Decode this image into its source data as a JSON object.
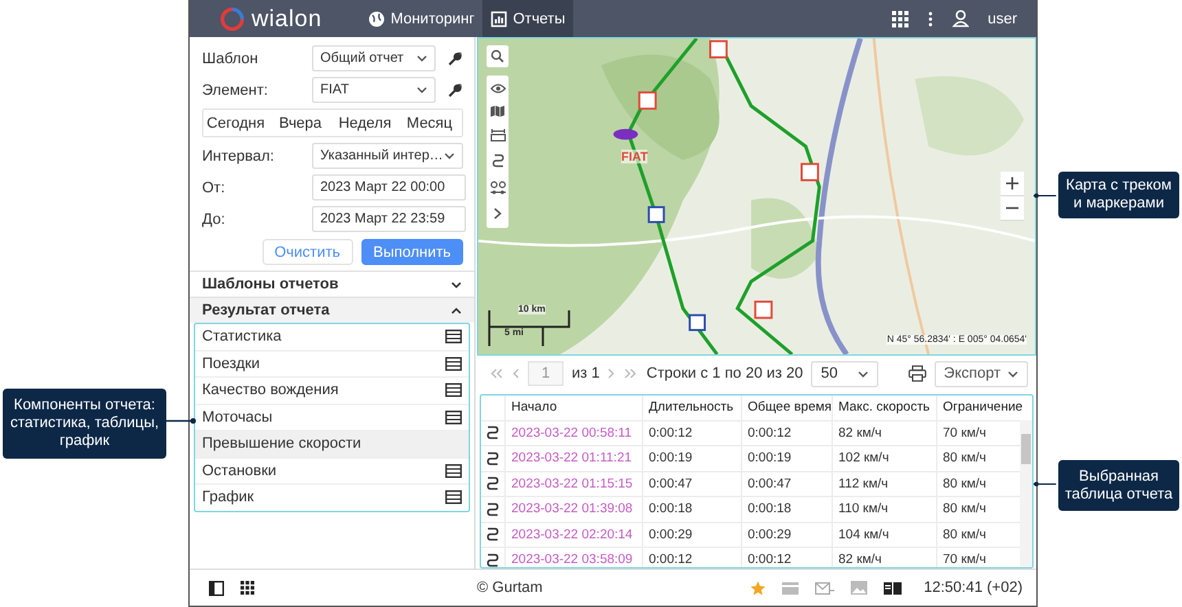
{
  "header": {
    "logo": "wialon",
    "nav": [
      {
        "label": "Мониторинг",
        "selected": false
      },
      {
        "label": "Отчеты",
        "selected": true
      }
    ],
    "user": "user"
  },
  "form": {
    "template": {
      "label": "Шаблон",
      "value": "Общий отчет"
    },
    "element": {
      "label": "Элемент:",
      "value": "FIAT"
    },
    "periods": [
      {
        "label": "Сегодня",
        "selected": false
      },
      {
        "label": "Вчера",
        "selected": false
      },
      {
        "label": "Неделя",
        "selected": false
      },
      {
        "label": "Месяц",
        "selected": false
      }
    ],
    "interval": {
      "label": "Интервал:",
      "value": "Указанный интер…"
    },
    "from": {
      "label": "От:",
      "value": "2023 Март 22 00:00"
    },
    "to": {
      "label": "До:",
      "value": "2023 Март 22 23:59"
    },
    "buttons": [
      {
        "label": "Очистить",
        "kind": "secondary"
      },
      {
        "label": "Выполнить",
        "kind": "primary"
      }
    ]
  },
  "sections": [
    {
      "title": "Шаблоны отчетов",
      "expanded": false
    },
    {
      "title": "Результат отчета",
      "expanded": true
    }
  ],
  "result_items": [
    {
      "label": "Статистика",
      "kind": "table"
    },
    {
      "label": "Поездки",
      "kind": "table"
    },
    {
      "label": "Качество вождения",
      "kind": "table"
    },
    {
      "label": "Моточасы",
      "kind": "table"
    },
    {
      "label": "Превышение скорости",
      "kind": "group"
    },
    {
      "label": "Остановки",
      "kind": "table"
    },
    {
      "label": "График",
      "kind": "table"
    }
  ],
  "map": {
    "unit_label": "FIAT",
    "scale": [
      "10 km",
      "5 mi"
    ],
    "coordinates": "N 45° 56.2834' : E 005° 04.0654'"
  },
  "pager": {
    "page": "1",
    "of": "из 1",
    "rows": "Строки с 1 по 20 из 20",
    "per_page": "50",
    "export": "Экспорт"
  },
  "table": {
    "columns": [
      "Начало",
      "Длительность",
      "Общее время",
      "Макс. скорость",
      "Ограничение"
    ],
    "rows": [
      [
        "2023-03-22 00:58:11",
        "0:00:12",
        "0:00:12",
        "82 км/ч",
        "70 км/ч"
      ],
      [
        "2023-03-22 01:11:21",
        "0:00:19",
        "0:00:19",
        "102 км/ч",
        "80 км/ч"
      ],
      [
        "2023-03-22 01:15:15",
        "0:00:47",
        "0:00:47",
        "112 км/ч",
        "80 км/ч"
      ],
      [
        "2023-03-22 01:39:08",
        "0:00:18",
        "0:00:18",
        "110 км/ч",
        "80 км/ч"
      ],
      [
        "2023-03-22 02:20:14",
        "0:00:29",
        "0:00:29",
        "104 км/ч",
        "80 км/ч"
      ],
      [
        "2023-03-22 03:58:09",
        "0:00:12",
        "0:00:12",
        "82 км/ч",
        "70 км/ч"
      ]
    ]
  },
  "footer": {
    "copyright": "© Gurtam",
    "time": "12:50:41 (+02)"
  },
  "callouts": [
    {
      "text": "Компоненты отчета: статистика, таблицы, график"
    },
    {
      "text": "Карта с треком и маркерами"
    },
    {
      "text": "Выбранная таблица отчета"
    }
  ]
}
